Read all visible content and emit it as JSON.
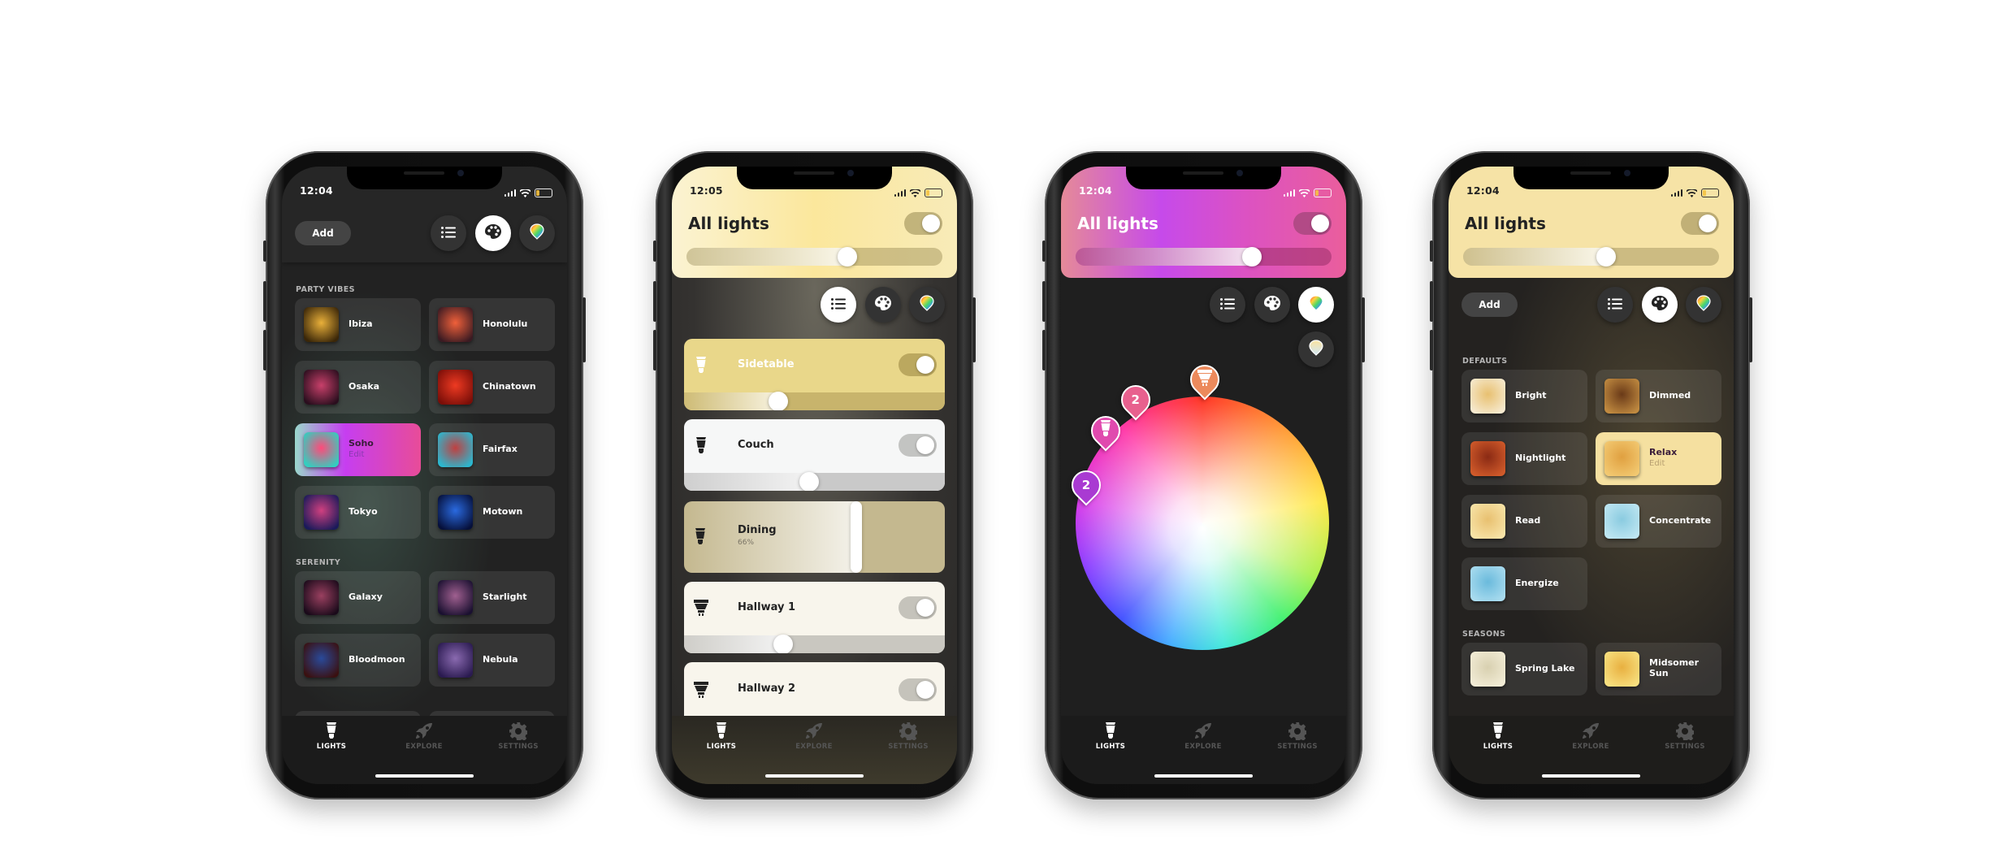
{
  "tabs": [
    {
      "label": "LIGHTS",
      "icon": "bulb-icon",
      "active": true
    },
    {
      "label": "EXPLORE",
      "icon": "rocket-icon",
      "active": false
    },
    {
      "label": "SETTINGS",
      "icon": "gear-icon",
      "active": false
    }
  ],
  "view_modes": [
    {
      "name": "list",
      "icon": "list-icon"
    },
    {
      "name": "scenes",
      "icon": "palette-icon"
    },
    {
      "name": "color",
      "icon": "color-picker-icon"
    }
  ],
  "screens": [
    {
      "time": "12:04",
      "add_label": "Add",
      "active_mode": "scenes",
      "sections": [
        {
          "title": "PARTY VIBES",
          "scenes": [
            {
              "name": "Ibiza",
              "thumb": [
                "#3a2608",
                "#e9b03a"
              ]
            },
            {
              "name": "Honolulu",
              "thumb": [
                "#3a1a22",
                "#f0603a"
              ]
            },
            {
              "name": "Osaka",
              "thumb": [
                "#2a0e1e",
                "#c8406a"
              ]
            },
            {
              "name": "Chinatown",
              "thumb": [
                "#7a0e08",
                "#ee3a22"
              ]
            },
            {
              "name": "Soho",
              "sub": "Edit",
              "thumb": [
                "#30d0c0",
                "#ff4a7a"
              ],
              "selected": true
            },
            {
              "name": "Fairfax",
              "thumb": [
                "#2ab8d0",
                "#c04040"
              ]
            },
            {
              "name": "Tokyo",
              "thumb": [
                "#1a1a5a",
                "#d04080"
              ]
            },
            {
              "name": "Motown",
              "thumb": [
                "#06103a",
                "#2a6ae0"
              ]
            }
          ]
        },
        {
          "title": "SERENITY",
          "scenes": [
            {
              "name": "Galaxy",
              "thumb": [
                "#1a0a1a",
                "#9a4060"
              ]
            },
            {
              "name": "Starlight",
              "thumb": [
                "#1a1030",
                "#a06090"
              ]
            },
            {
              "name": "Bloodmoon",
              "thumb": [
                "#3a1010",
                "#2a4a9a"
              ]
            },
            {
              "name": "Nebula",
              "thumb": [
                "#2a1a50",
                "#8a6ab0"
              ]
            }
          ]
        }
      ]
    },
    {
      "time": "12:05",
      "header": {
        "title": "All lights",
        "on": true,
        "brightness": 0.63
      },
      "active_mode": "list",
      "lights": [
        {
          "name": "Sidetable",
          "on": true,
          "brightness": 0.36,
          "color": "#e9d78a"
        },
        {
          "name": "Couch",
          "on": true,
          "brightness": 0.48,
          "color": "#f6f7f7"
        },
        {
          "name": "Dining",
          "status": "66%",
          "brightness": 0.66,
          "color": "#c4b88f"
        },
        {
          "name": "Hallway 1",
          "on": true,
          "brightness": 0.38,
          "color": "#f8f5ec"
        },
        {
          "name": "Hallway 2",
          "on": true,
          "color": "#f8f5ec"
        }
      ]
    },
    {
      "time": "12:04",
      "header": {
        "title": "All lights",
        "on": true,
        "brightness": 0.69
      },
      "active_mode": "color",
      "extra_mode": {
        "name": "white-temperature",
        "icon": "white-temperature-icon"
      },
      "pins": [
        {
          "icon": "spot-bulb-icon",
          "hue": 1,
          "color": "#ec8a5c"
        },
        {
          "label": "2",
          "hue": 325,
          "color": "#e8608e"
        },
        {
          "icon": "bulb-icon",
          "hue": 304,
          "color": "#e04aae"
        },
        {
          "label": "2",
          "hue": 275,
          "color": "#a93ad2"
        }
      ]
    },
    {
      "time": "12:04",
      "header": {
        "title": "All lights",
        "on": true,
        "brightness": 0.56
      },
      "add_label": "Add",
      "active_mode": "scenes",
      "sections": [
        {
          "title": "DEFAULTS",
          "scenes": [
            {
              "name": "Bright",
              "thumb": [
                "#f6ead0",
                "#e8c070"
              ]
            },
            {
              "name": "Dimmed",
              "thumb": [
                "#c08a40",
                "#6a3a18"
              ]
            },
            {
              "name": "Nightlight",
              "thumb": [
                "#d05a2a",
                "#8a2a14"
              ]
            },
            {
              "name": "Relax",
              "sub": "Edit",
              "thumb": [
                "#f2c870",
                "#e0a040"
              ],
              "selected": true
            },
            {
              "name": "Read",
              "thumb": [
                "#f8e4a8",
                "#e8c070"
              ]
            },
            {
              "name": "Concentrate",
              "thumb": [
                "#bfe6f2",
                "#8acbe0"
              ]
            },
            {
              "name": "Energize",
              "thumb": [
                "#aadcef",
                "#6abadc"
              ]
            }
          ]
        },
        {
          "title": "SEASONS",
          "scenes": [
            {
              "name": "Spring Lake",
              "thumb": [
                "#f2ecd6",
                "#d8d0b0"
              ]
            },
            {
              "name": "Midsomer Sun",
              "thumb": [
                "#f8e080",
                "#e8b040"
              ]
            }
          ]
        }
      ]
    }
  ]
}
